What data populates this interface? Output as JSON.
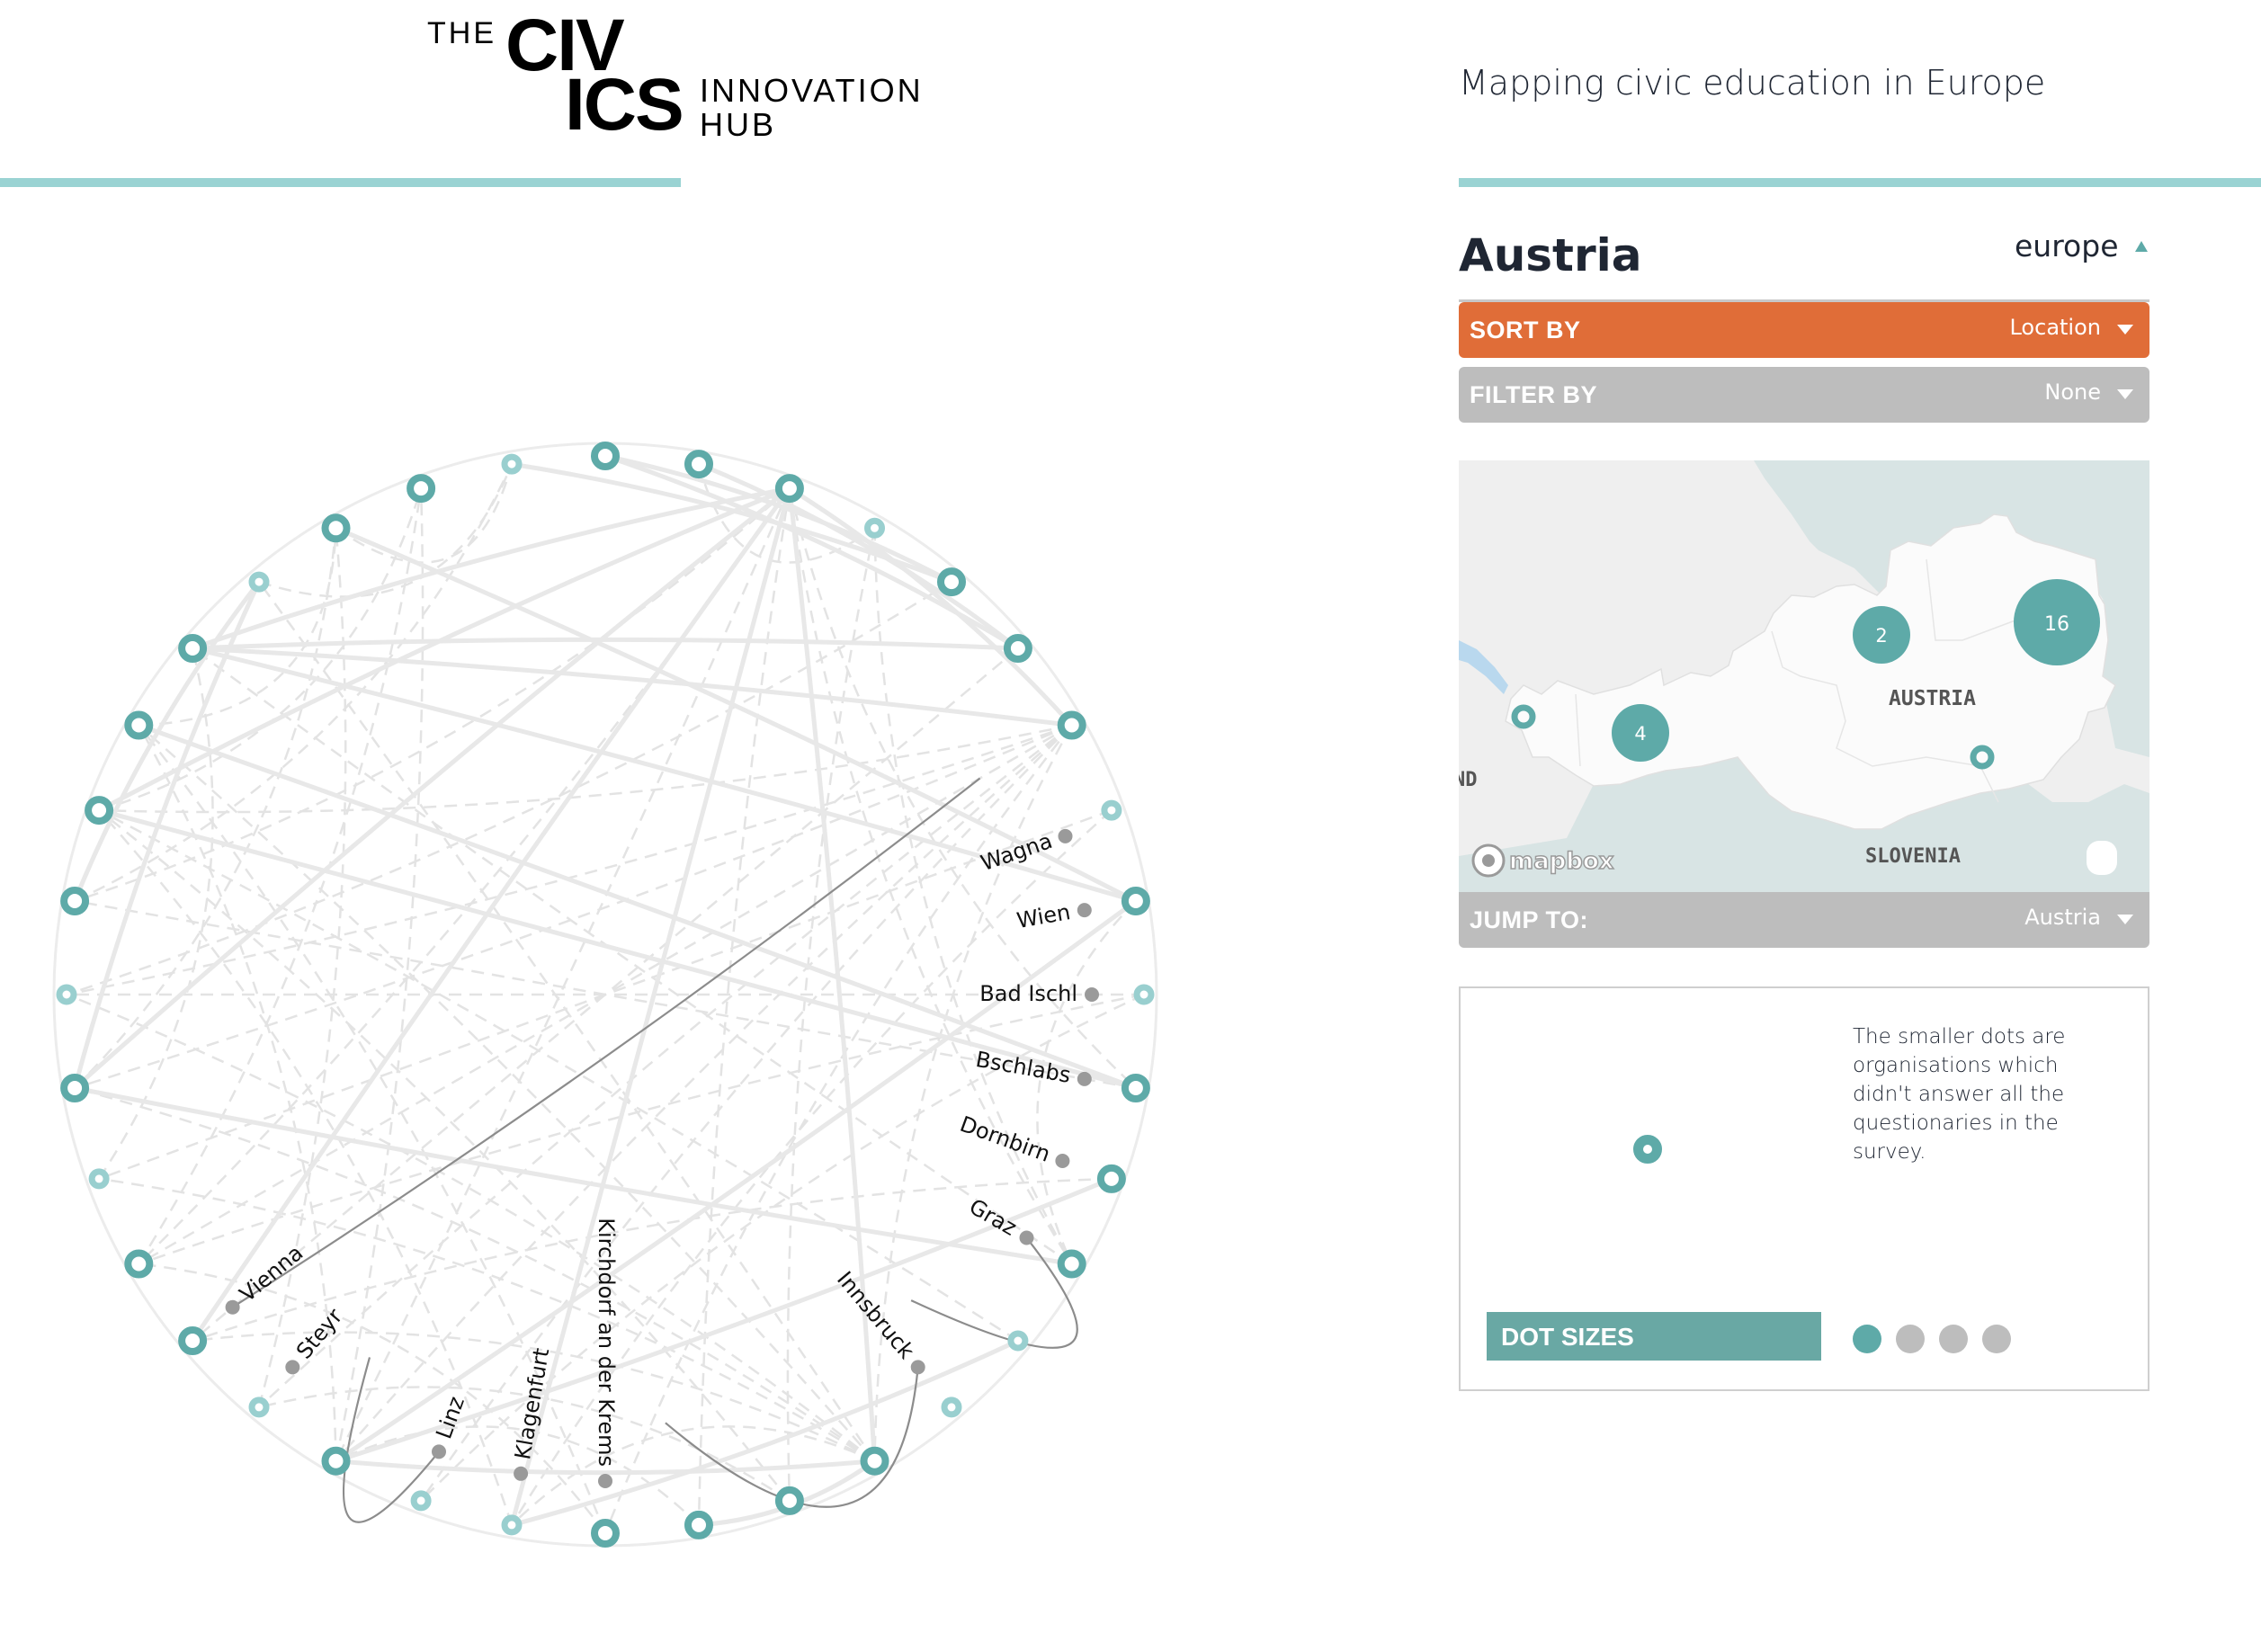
{
  "header": {
    "logo": {
      "the": "THE",
      "civ": "CIV",
      "ics": "ICS",
      "innovation": "INNOVATION",
      "hub": "HUB"
    },
    "tagline": "Mapping civic education in Europe"
  },
  "panel": {
    "country": "Austria",
    "region": "europe",
    "sort": {
      "label": "SORT BY",
      "value": "Location"
    },
    "filter": {
      "label": "FILTER BY",
      "value": "None"
    },
    "jump": {
      "label": "JUMP TO:",
      "value": "Austria"
    },
    "map": {
      "labels": {
        "country": "AUSTRIA",
        "south": "SLOVENIA",
        "west_partial": "ND"
      },
      "attribution": "mapbox",
      "clusters": [
        {
          "count": "16",
          "region": "east"
        },
        {
          "count": "2",
          "region": "north"
        },
        {
          "count": "4",
          "region": "west"
        }
      ],
      "single_markers": 2
    },
    "legend": {
      "note": "The smaller dots are organisations which didn't answer all the questionaries in the survey.",
      "dot_sizes_label": "DOT SIZES",
      "dot_size_options": 4,
      "dot_size_selected": 1
    }
  },
  "colors": {
    "teal": "#5eaaa8",
    "teal_light": "#99cfcf",
    "accent_bar": "#9ad3d3",
    "sort_orange": "#e06d38",
    "bar_gray": "#bdbdbd",
    "label_dot": "#9a9a9a",
    "dot_label_bg": "#69a8a4"
  },
  "chord": {
    "outer_nodes": [
      {
        "angle_deg": -90,
        "size": "large"
      },
      {
        "angle_deg": -80,
        "size": "large"
      },
      {
        "angle_deg": -70,
        "size": "large"
      },
      {
        "angle_deg": -60,
        "size": "small"
      },
      {
        "angle_deg": -50,
        "size": "large"
      },
      {
        "angle_deg": -40,
        "size": "large"
      },
      {
        "angle_deg": -30,
        "size": "large"
      },
      {
        "angle_deg": -20,
        "size": "small"
      },
      {
        "angle_deg": -10,
        "size": "large"
      },
      {
        "angle_deg": 0,
        "size": "small"
      },
      {
        "angle_deg": 10,
        "size": "large"
      },
      {
        "angle_deg": 20,
        "size": "large"
      },
      {
        "angle_deg": 30,
        "size": "large"
      },
      {
        "angle_deg": 40,
        "size": "small"
      },
      {
        "angle_deg": 50,
        "size": "small"
      },
      {
        "angle_deg": 60,
        "size": "large"
      },
      {
        "angle_deg": 70,
        "size": "large"
      },
      {
        "angle_deg": 80,
        "size": "large"
      },
      {
        "angle_deg": 90,
        "size": "large"
      },
      {
        "angle_deg": 100,
        "size": "small"
      },
      {
        "angle_deg": 110,
        "size": "small"
      },
      {
        "angle_deg": 120,
        "size": "large"
      },
      {
        "angle_deg": 130,
        "size": "small"
      },
      {
        "angle_deg": 140,
        "size": "large"
      },
      {
        "angle_deg": 150,
        "size": "large"
      },
      {
        "angle_deg": 160,
        "size": "small"
      },
      {
        "angle_deg": 170,
        "size": "large"
      },
      {
        "angle_deg": 180,
        "size": "small"
      },
      {
        "angle_deg": 190,
        "size": "large"
      },
      {
        "angle_deg": 200,
        "size": "large"
      },
      {
        "angle_deg": 210,
        "size": "large"
      },
      {
        "angle_deg": 220,
        "size": "large"
      },
      {
        "angle_deg": 230,
        "size": "small"
      },
      {
        "angle_deg": 240,
        "size": "large"
      },
      {
        "angle_deg": 250,
        "size": "large"
      },
      {
        "angle_deg": 260,
        "size": "small"
      }
    ],
    "locations": [
      {
        "name": "Wagna",
        "angle_deg": -19
      },
      {
        "name": "Wien",
        "angle_deg": -10
      },
      {
        "name": "Bad Ischl",
        "angle_deg": 0
      },
      {
        "name": "Bschlabs",
        "angle_deg": 10
      },
      {
        "name": "Dornbirn",
        "angle_deg": 20
      },
      {
        "name": "Graz",
        "angle_deg": 30
      },
      {
        "name": "Innsbruck",
        "angle_deg": 50
      },
      {
        "name": "Kirchdorf an der Krems",
        "angle_deg": 90
      },
      {
        "name": "Klagenfurt",
        "angle_deg": 100
      },
      {
        "name": "Linz",
        "angle_deg": 110
      },
      {
        "name": "Steyr",
        "angle_deg": 130
      },
      {
        "name": "Vienna",
        "angle_deg": 140
      }
    ],
    "dark_links": [
      {
        "from_location": "Vienna",
        "to_angle_deg": -30
      },
      {
        "from_location": "Graz",
        "to_angle_deg": 45
      },
      {
        "from_location": "Innsbruck",
        "to_angle_deg": 82
      },
      {
        "from_location": "Linz",
        "to_angle_deg": 123
      }
    ],
    "solid_links": [
      [
        -70,
        -30
      ],
      [
        -70,
        140
      ],
      [
        -70,
        60
      ],
      [
        -70,
        100
      ],
      [
        -70,
        170
      ],
      [
        -70,
        200
      ],
      [
        -80,
        -40
      ],
      [
        -90,
        -40
      ],
      [
        -100,
        -50
      ],
      [
        -120,
        -10
      ],
      [
        -150,
        10
      ],
      [
        -190,
        30
      ],
      [
        220,
        -30
      ],
      [
        220,
        -40
      ],
      [
        220,
        -70
      ],
      [
        220,
        -10
      ],
      [
        200,
        10
      ],
      [
        120,
        20
      ],
      [
        120,
        60
      ],
      [
        120,
        -10
      ],
      [
        80,
        60
      ],
      [
        100,
        40
      ],
      [
        170,
        230
      ],
      [
        190,
        230
      ],
      [
        -90,
        -50
      ]
    ],
    "dashed_links": [
      [
        -70,
        120
      ],
      [
        -70,
        150
      ],
      [
        -70,
        80
      ],
      [
        -70,
        30
      ],
      [
        -70,
        190
      ],
      [
        -70,
        10
      ],
      [
        -30,
        150
      ],
      [
        -30,
        170
      ],
      [
        -30,
        180
      ],
      [
        -30,
        200
      ],
      [
        -30,
        130
      ],
      [
        -30,
        110
      ],
      [
        -30,
        90
      ],
      [
        -30,
        120
      ],
      [
        -30,
        60
      ],
      [
        -60,
        70
      ],
      [
        -60,
        30
      ],
      [
        -50,
        180
      ],
      [
        -40,
        140
      ],
      [
        -20,
        160
      ],
      [
        -20,
        100
      ],
      [
        0,
        180
      ],
      [
        0,
        150
      ],
      [
        0,
        110
      ],
      [
        10,
        190
      ],
      [
        20,
        140
      ],
      [
        30,
        220
      ],
      [
        40,
        200
      ],
      [
        60,
        160
      ],
      [
        60,
        100
      ],
      [
        60,
        140
      ],
      [
        60,
        170
      ],
      [
        60,
        180
      ],
      [
        60,
        210
      ],
      [
        60,
        230
      ],
      [
        70,
        130
      ],
      [
        70,
        200
      ],
      [
        80,
        120
      ],
      [
        90,
        150
      ],
      [
        90,
        210
      ],
      [
        100,
        200
      ],
      [
        120,
        210
      ],
      [
        120,
        250
      ],
      [
        130,
        240
      ],
      [
        150,
        250
      ],
      [
        160,
        220
      ],
      [
        170,
        240
      ],
      [
        190,
        260
      ],
      [
        200,
        250
      ],
      [
        210,
        240
      ],
      [
        230,
        260
      ],
      [
        240,
        260
      ],
      [
        -80,
        -60
      ],
      [
        -10,
        30
      ]
    ]
  }
}
